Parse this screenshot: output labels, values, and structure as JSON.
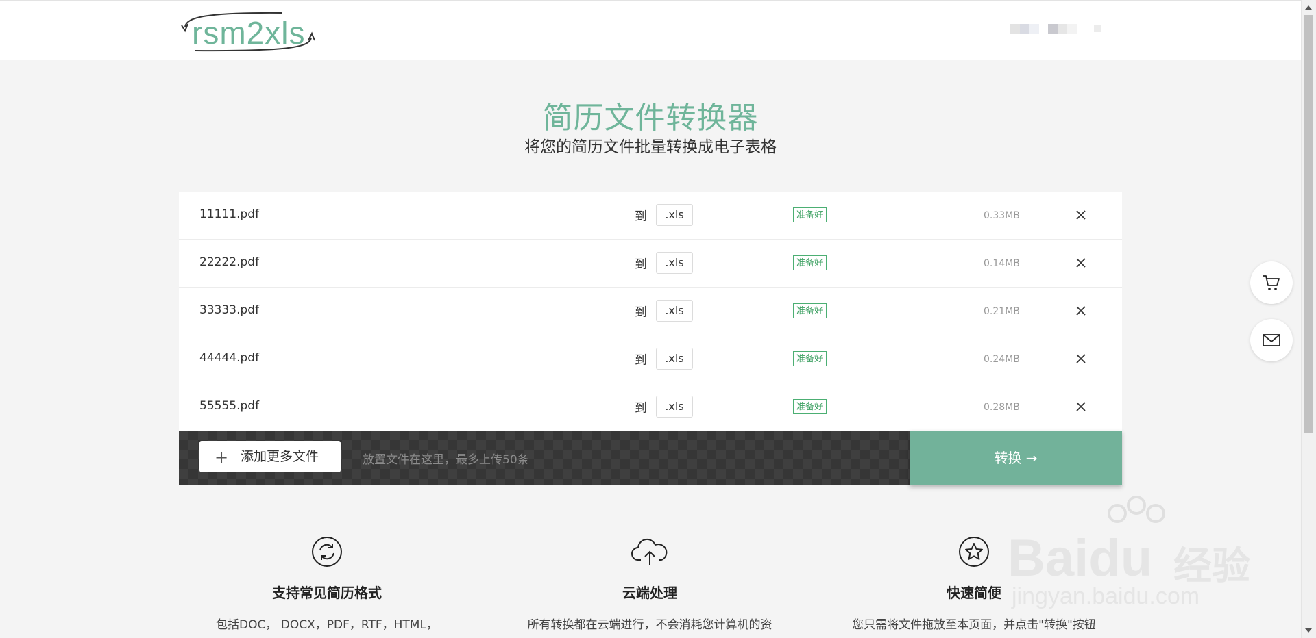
{
  "header": {
    "logo_text": "rsm2xls"
  },
  "hero": {
    "title": "简历文件转换器",
    "subtitle": "将您的简历文件批量转换成电子表格"
  },
  "files": [
    {
      "name": "11111.pdf",
      "to": "到",
      "format": ".xls",
      "status": "准备好",
      "size": "0.33MB"
    },
    {
      "name": "22222.pdf",
      "to": "到",
      "format": ".xls",
      "status": "准备好",
      "size": "0.14MB"
    },
    {
      "name": "33333.pdf",
      "to": "到",
      "format": ".xls",
      "status": "准备好",
      "size": "0.21MB"
    },
    {
      "name": "44444.pdf",
      "to": "到",
      "format": ".xls",
      "status": "准备好",
      "size": "0.24MB"
    },
    {
      "name": "55555.pdf",
      "to": "到",
      "format": ".xls",
      "status": "准备好",
      "size": "0.28MB"
    }
  ],
  "upload": {
    "add_label": "添加更多文件",
    "drop_hint": "放置文件在这里，最多上传50条",
    "convert_label": "转换 →"
  },
  "features": [
    {
      "icon": "sync-icon",
      "title": "支持常见简历格式",
      "desc": "包括DOC， DOCX，PDF，RTF，HTML，"
    },
    {
      "icon": "cloud-upload-icon",
      "title": "云端处理",
      "desc": "所有转换都在云端进行，不会消耗您计算机的资"
    },
    {
      "icon": "star-icon",
      "title": "快速简便",
      "desc": "您只需将文件拖放至本页面，并点击\"转换\"按钮"
    }
  ],
  "watermark": {
    "brand": "Baidu",
    "cn": "经验",
    "url": "jingyan.baidu.com"
  },
  "colors": {
    "accent": "#72b29a",
    "logo": "#6fb59a",
    "status_green": "#3ea163",
    "dark_bar": "#3f3f3f"
  }
}
